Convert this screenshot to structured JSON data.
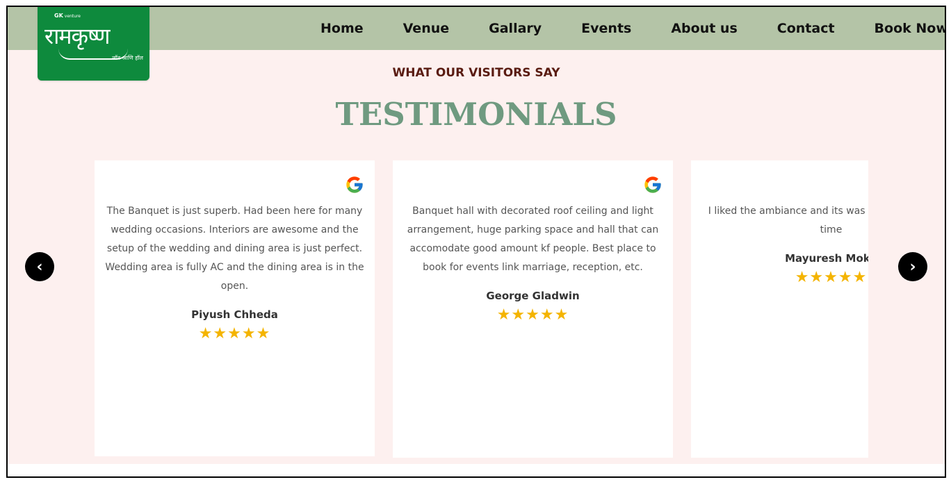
{
  "logo": {
    "brand_prefix": "GK",
    "brand_suffix": "venture",
    "name": "रामकृष्ण",
    "tagline": "लॉन आणि हॉल"
  },
  "nav": {
    "items": [
      {
        "label": "Home"
      },
      {
        "label": "Venue"
      },
      {
        "label": "Gallary"
      },
      {
        "label": "Events"
      },
      {
        "label": "About us"
      },
      {
        "label": "Contact"
      },
      {
        "label": "Book Now"
      }
    ]
  },
  "testimonials": {
    "eyebrow": "WHAT OUR VISITORS SAY",
    "heading": "TESTIMONIALS",
    "prev_arrow": "‹",
    "next_arrow": "›",
    "cards": [
      {
        "text": "The Banquet is just superb. Had been here for many wedding occasions. Interiors are awesome and the setup of the wedding and dining area is just perfect. Wedding area is fully AC and the dining area is in the open.",
        "name": "Piyush Chheda",
        "stars": "★★★★★",
        "rating": 5
      },
      {
        "text": "Banquet hall with decorated roof ceiling and light arrangement, huge parking space and hall that can accomodate good amount kf people. Best place to book for events link marriage, reception, etc.",
        "name": "George Gladwin",
        "stars": "★★★★★",
        "rating": 5
      },
      {
        "text": "I liked the ambiance and its was this place for first time",
        "name": "Mayuresh Moka",
        "stars": "★★★★★",
        "rating": 5
      }
    ]
  },
  "colors": {
    "nav_bg": "#b4c4a7",
    "logo_bg": "#0e8a3d",
    "section_bg": "#fdf0ef",
    "eyebrow": "#5a1c12",
    "heading": "#6f9a80",
    "star": "#f4b400"
  },
  "icons": {
    "google": "google-g-icon",
    "prev": "chevron-left-icon",
    "next": "chevron-right-icon"
  }
}
